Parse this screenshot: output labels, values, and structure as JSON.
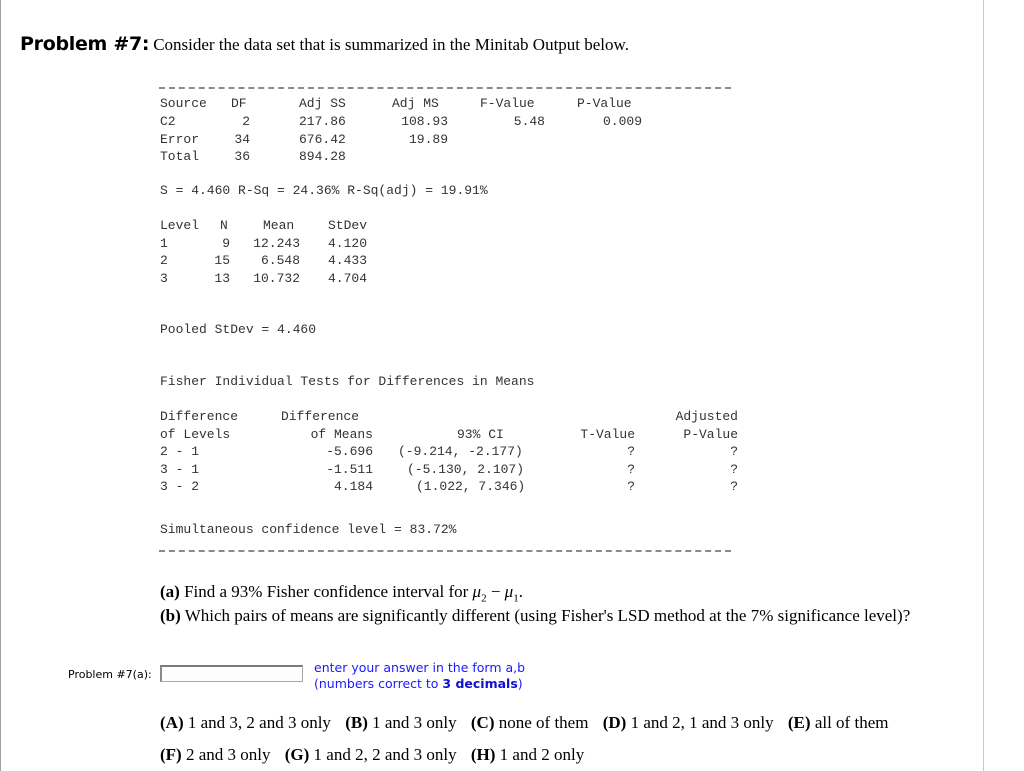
{
  "header": {
    "problem_label": "Problem #7:",
    "intro": "Consider the data set that is summarized in the Minitab Output below."
  },
  "anova": {
    "headers": [
      "Source",
      "DF",
      "Adj SS",
      "Adj MS",
      "F-Value",
      "P-Value"
    ],
    "rows": [
      [
        "C2",
        "2",
        "217.86",
        "108.93",
        "5.48",
        "0.009"
      ],
      [
        "Error",
        "34",
        "676.42",
        "19.89",
        "",
        ""
      ],
      [
        "Total",
        "36",
        "894.28",
        "",
        "",
        ""
      ]
    ],
    "summary": "S = 4.460 R-Sq = 24.36% R-Sq(adj) = 19.91%"
  },
  "means": {
    "headers": [
      "Level",
      "N",
      "Mean",
      "StDev"
    ],
    "rows": [
      [
        "1",
        "9",
        "12.243",
        "4.120"
      ],
      [
        "2",
        "15",
        "6.548",
        "4.433"
      ],
      [
        "3",
        "13",
        "10.732",
        "4.704"
      ]
    ],
    "pooled": "Pooled StDev = 4.460"
  },
  "fisher": {
    "title": "Fisher Individual Tests for Differences in Means",
    "headers_line1": [
      "Difference",
      "Difference",
      "",
      "",
      "Adjusted"
    ],
    "headers_line2": [
      "of Levels",
      "of Means",
      "93% CI",
      "T-Value",
      "P-Value"
    ],
    "rows": [
      [
        "2 - 1",
        "-5.696",
        "(-9.214, -2.177)",
        "?",
        "?"
      ],
      [
        "3 - 1",
        "-1.511",
        "(-5.130, 2.107)",
        "?",
        "?"
      ],
      [
        "3 - 2",
        "4.184",
        "(1.022, 7.346)",
        "?",
        "?"
      ]
    ],
    "simultaneous": "Simultaneous confidence level = 83.72%"
  },
  "questions": {
    "a_tag": "(a)",
    "a_text": "Find a 93% Fisher confidence interval for",
    "a_expr_mu2": "μ",
    "a_sub2": "2",
    "a_minus": " − ",
    "a_expr_mu1": "μ",
    "a_sub1": "1",
    "a_end": ".",
    "b_tag": "(b)",
    "b_text": "Which pairs of means are significantly different (using Fisher's LSD method at the 7% significance level)?"
  },
  "answer": {
    "label": "Problem #7(a):",
    "value": "",
    "placeholder": "",
    "hint_line1": "enter your answer in the form a,b",
    "hint_line2_pre": "(numbers correct to ",
    "hint_line2_bold": "3 decimals",
    "hint_line2_post": ")"
  },
  "choices": {
    "row1": [
      {
        "tag": "(A)",
        "text": "1 and 3, 2 and 3 only"
      },
      {
        "tag": "(B)",
        "text": "1 and 3 only"
      },
      {
        "tag": "(C)",
        "text": "none of them"
      },
      {
        "tag": "(D)",
        "text": "1 and 2, 1 and 3 only"
      },
      {
        "tag": "(E)",
        "text": "all of them"
      }
    ],
    "row2": [
      {
        "tag": "(F)",
        "text": "2 and 3 only"
      },
      {
        "tag": "(G)",
        "text": "1 and 2, 2 and 3 only"
      },
      {
        "tag": "(H)",
        "text": "1 and 2 only"
      }
    ]
  }
}
